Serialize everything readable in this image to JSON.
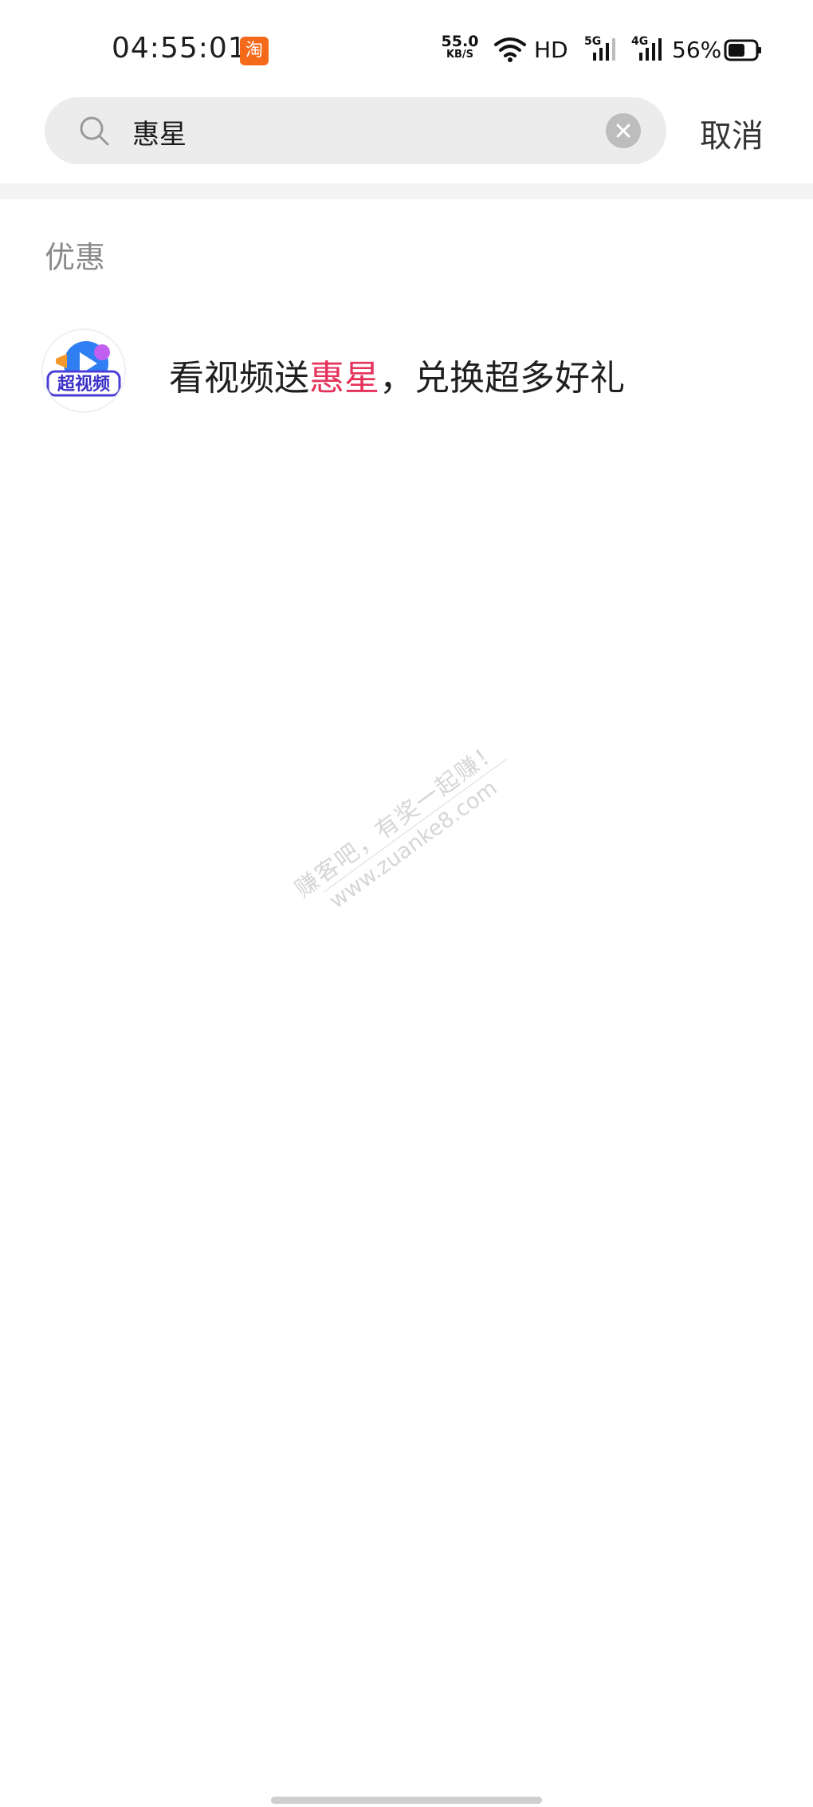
{
  "status_bar": {
    "time": "04:55:01",
    "notification_app_icon": "taobao-icon",
    "notification_app_glyph": "淘",
    "net_speed_value": "55.0",
    "net_speed_unit": "KB/S",
    "hd_label": "HD",
    "signal_5g_label": "5G",
    "signal_4g_label": "4G",
    "battery_percent": "56%"
  },
  "search": {
    "query": "惠星",
    "cancel_label": "取消",
    "search_icon": "search-icon",
    "clear_icon": "close-icon"
  },
  "results": {
    "section_title": "优惠",
    "items": [
      {
        "text_before": "看视频送",
        "text_highlight": "惠星",
        "text_after": "，兑换超多好礼",
        "app_logo_text": "超视频",
        "icon": "video-app-logo-icon"
      }
    ]
  },
  "watermark": {
    "line1": "赚客吧，有奖一起赚！",
    "line2": "www.zuanke8.com"
  },
  "colors": {
    "highlight": "#e5325b",
    "section_title": "#8a8a8a",
    "search_bg": "#ececec"
  }
}
